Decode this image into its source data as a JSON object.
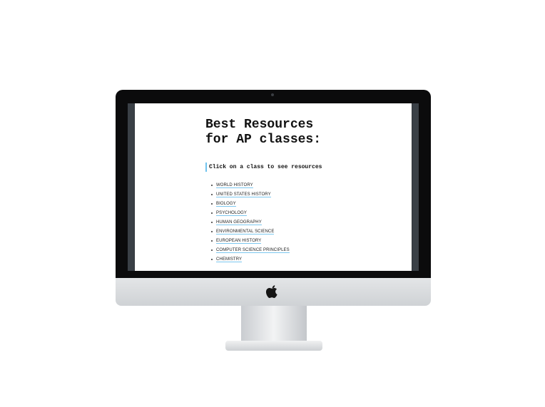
{
  "page": {
    "title_line1": "Best Resources",
    "title_line2": "for AP classes:",
    "subtitle": "Click on a class to see resources",
    "classes": [
      "WORLD HISTORY",
      "UNITED STATES HISTORY",
      "BIOLOGY",
      "PSYCHOLOGY",
      "HUMAN GEOGRAPHY",
      "ENVIRONMENTAL SCIENCE",
      "EUROPEAN HISTORY",
      "COMPUTER SCIENCE PRINCIPLES",
      "CHEMISTRY"
    ]
  },
  "device": {
    "logo_icon": "apple-logo-icon"
  },
  "colors": {
    "link_underline": "#7cc7ef",
    "subtitle_bar": "#6fc3ee",
    "bezel": "#0b0b0c"
  }
}
